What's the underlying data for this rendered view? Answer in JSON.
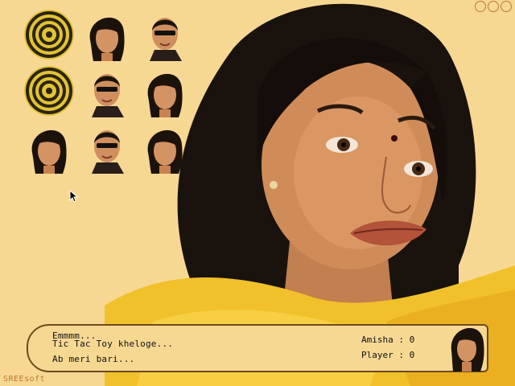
{
  "dialog": {
    "line1": "Emmmm...",
    "line2": "Tic Tac Toy kheloge...",
    "line3": "Ab meri bari..."
  },
  "scores": {
    "amisha_label": "Amisha : 0",
    "player_label": "Player : 0"
  },
  "brand": "SREEsoft",
  "board": {
    "cells": [
      {
        "mark": "target"
      },
      {
        "mark": "amisha"
      },
      {
        "mark": "player"
      },
      {
        "mark": "target"
      },
      {
        "mark": "player"
      },
      {
        "mark": "amisha"
      },
      {
        "mark": "amisha"
      },
      {
        "mark": "player"
      },
      {
        "mark": "amisha"
      }
    ]
  },
  "colors": {
    "background": "#f7d893",
    "panel_border": "#6e4a1e",
    "brand_text": "#c0762e",
    "target_gold": "#d9b520",
    "window_button": "#c0763a"
  },
  "icons": [
    "target-icon",
    "amisha-token-icon",
    "player-token-icon",
    "cursor-icon"
  ]
}
